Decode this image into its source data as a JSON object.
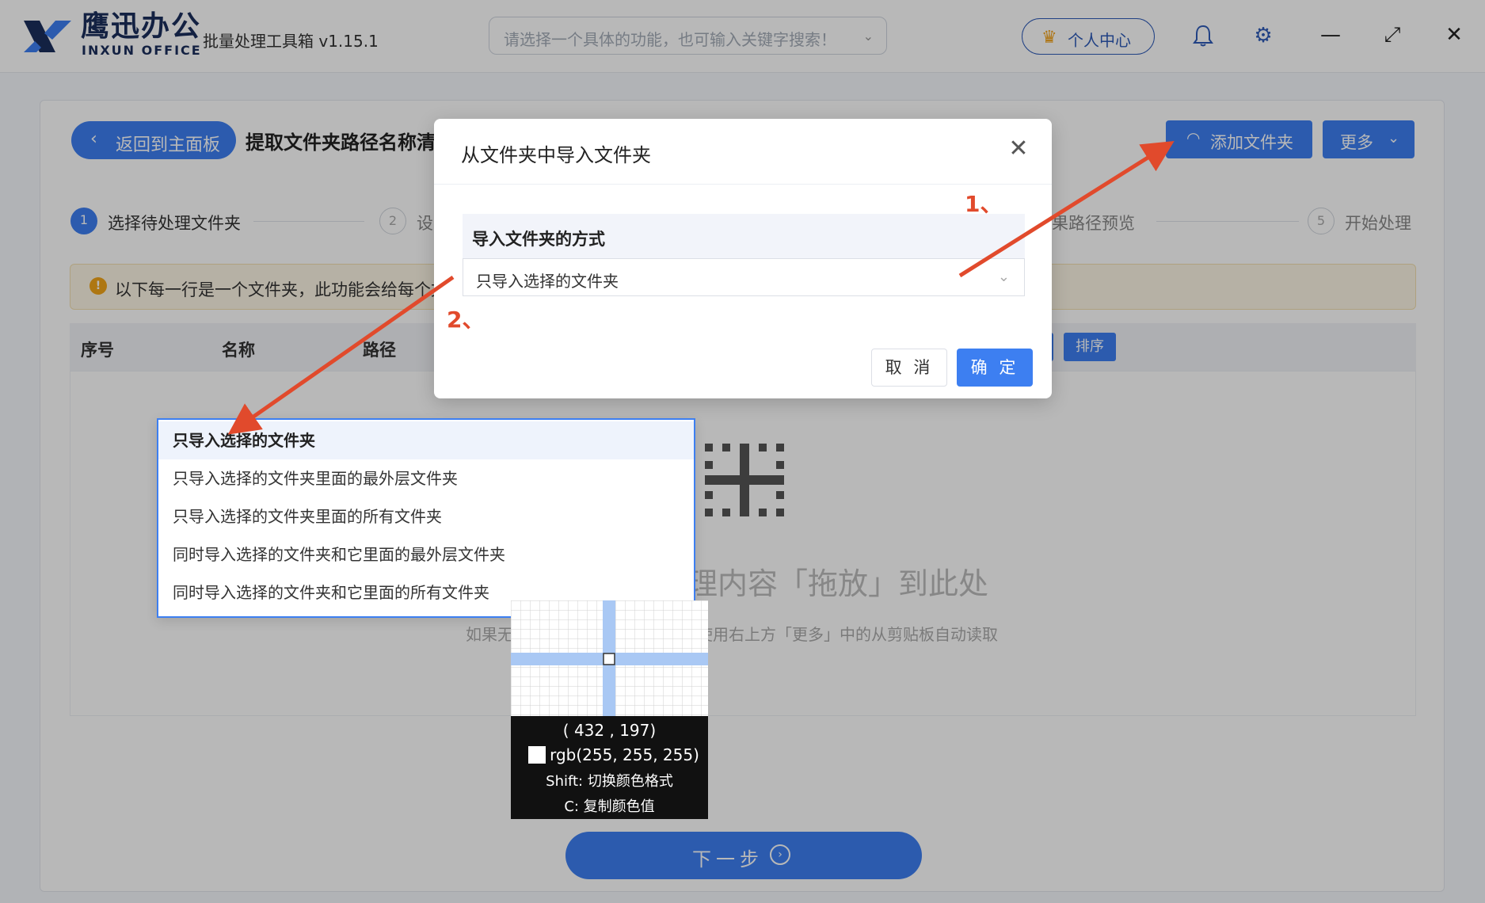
{
  "app": {
    "brand_cn": "鹰迅办公",
    "brand_en": "INXUN OFFICE",
    "title": "批量处理工具箱 v1.15.1",
    "search_placeholder": "请选择一个具体的功能，也可输入关键字搜索！",
    "user_center": "个人中心",
    "icons": [
      "bell-icon",
      "gear-icon",
      "minimize-icon",
      "maximize-icon",
      "close-icon"
    ]
  },
  "page": {
    "back": "返回到主面板",
    "title": "提取文件夹路径名称清",
    "add_folder": "添加文件夹",
    "more": "更多",
    "steps": [
      {
        "num": "1",
        "label": "选择待处理文件夹"
      },
      {
        "num": "2",
        "label": "设"
      },
      {
        "num": "",
        "label": "果路径预览"
      },
      {
        "num": "5",
        "label": "开始处理"
      }
    ],
    "notice": "以下每一行是一个文件夹，此功能会给每个文",
    "columns": [
      "序号",
      "名称",
      "路径"
    ],
    "table_buttons": [
      "排序"
    ],
    "drop_text": "理内容「拖放」到此处",
    "drop_sub_left": "如果无",
    "drop_sub_right": "使用右上方「更多」中的从剪贴板自动读取",
    "next": "下一步"
  },
  "dialog": {
    "title": "从文件夹中导入文件夹",
    "field_label": "导入文件夹的方式",
    "selected": "只导入选择的文件夹",
    "cancel": "取 消",
    "ok": "确 定"
  },
  "dropdown": {
    "options": [
      "只导入选择的文件夹",
      "只导入选择的文件夹里面的最外层文件夹",
      "只导入选择的文件夹里面的所有文件夹",
      "同时导入选择的文件夹和它里面的最外层文件夹",
      "同时导入选择的文件夹和它里面的所有文件夹"
    ],
    "selected_index": 0
  },
  "magnifier": {
    "coords": "( 432 ,  197)",
    "color": "rgb(255, 255, 255)",
    "hint1": "Shift: 切换颜色格式",
    "hint2": "C: 复制颜色值"
  },
  "annotations": [
    "1、",
    "2、"
  ],
  "colors": {
    "accent": "#3d7ff1",
    "brand": "#1b2e5c",
    "annotation": "#e14a2c"
  }
}
